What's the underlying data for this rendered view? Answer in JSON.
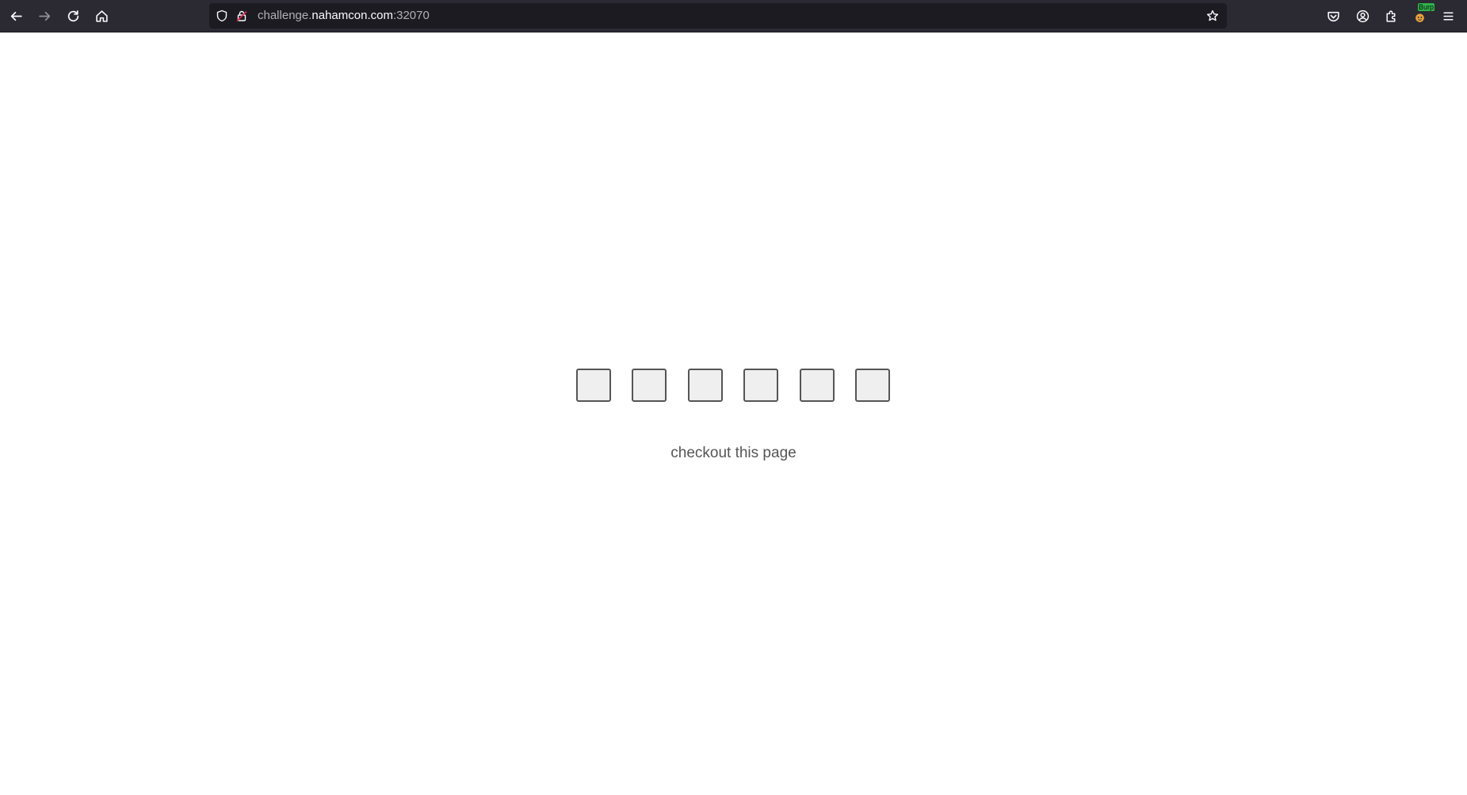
{
  "browser": {
    "url": {
      "prefix": "challenge.",
      "host": "nahamcon.com",
      "port_suffix": ":32070"
    },
    "extension_badge": "Burp",
    "toolbar_icons": {
      "back": "arrow-left-icon",
      "forward": "arrow-right-icon",
      "reload": "reload-icon",
      "home": "home-icon",
      "tracking": "shield-icon",
      "lock": "lock-icon",
      "bookmark": "star-icon",
      "pocket": "pocket-icon",
      "account": "account-icon",
      "extensions": "puzzle-icon",
      "menu": "hamburger-menu-icon"
    }
  },
  "page": {
    "boxes": [
      {
        "value": ""
      },
      {
        "value": ""
      },
      {
        "value": ""
      },
      {
        "value": ""
      },
      {
        "value": ""
      },
      {
        "value": ""
      }
    ],
    "caption": "checkout this page"
  },
  "colors": {
    "toolbar_bg": "#2b2a33",
    "urlbar_bg": "#1c1b22",
    "box_border": "#555555",
    "box_fill": "#efefef",
    "caption_text": "#555555"
  }
}
